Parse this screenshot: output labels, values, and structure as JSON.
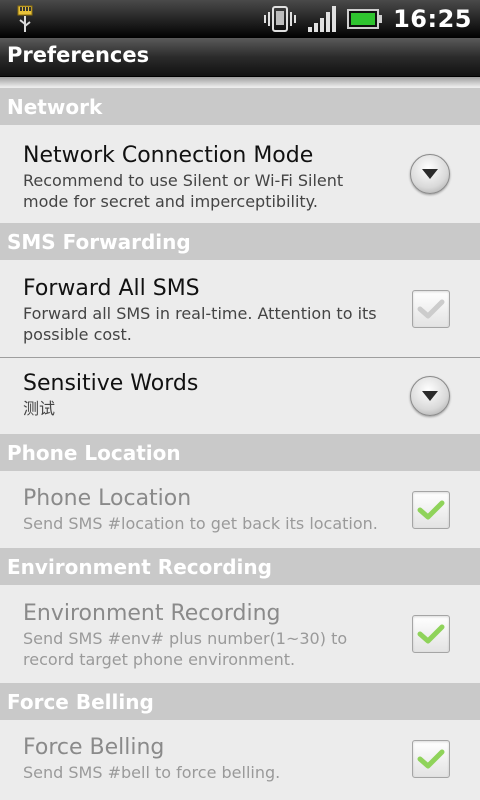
{
  "status_bar": {
    "time": "16:25"
  },
  "title": "Preferences",
  "sections": [
    {
      "header": "Network",
      "items": [
        {
          "title": "Network Connection Mode",
          "summary": "Recommend to use Silent or Wi-Fi Silent mode for secret and imperceptibility.",
          "control": "dropdown-icon"
        }
      ]
    },
    {
      "header": "SMS Forwarding",
      "items": [
        {
          "title": "Forward All SMS",
          "summary": "Forward all SMS in real-time. Attention to its possible cost.",
          "control": "checkbox",
          "checked": false
        },
        {
          "title": "Sensitive Words",
          "summary": "测试",
          "control": "dropdown-icon"
        }
      ]
    },
    {
      "header": "Phone Location",
      "items": [
        {
          "title": "Phone Location",
          "summary": "Send SMS #location to get back its location.",
          "control": "checkbox",
          "checked": true,
          "disabled": true
        }
      ]
    },
    {
      "header": "Environment Recording",
      "items": [
        {
          "title": "Environment Recording",
          "summary": "Send SMS #env# plus number(1~30) to record target phone environment.",
          "control": "checkbox",
          "checked": true,
          "disabled": true
        }
      ]
    },
    {
      "header": "Force Belling",
      "items": [
        {
          "title": "Force Belling",
          "summary": "Send SMS #bell to force belling.",
          "control": "checkbox",
          "checked": true,
          "disabled": true
        }
      ]
    }
  ],
  "colors": {
    "category_bg": "#c9c9c9",
    "check_green": "#7fd03a",
    "check_gray": "#c8c8c8"
  }
}
